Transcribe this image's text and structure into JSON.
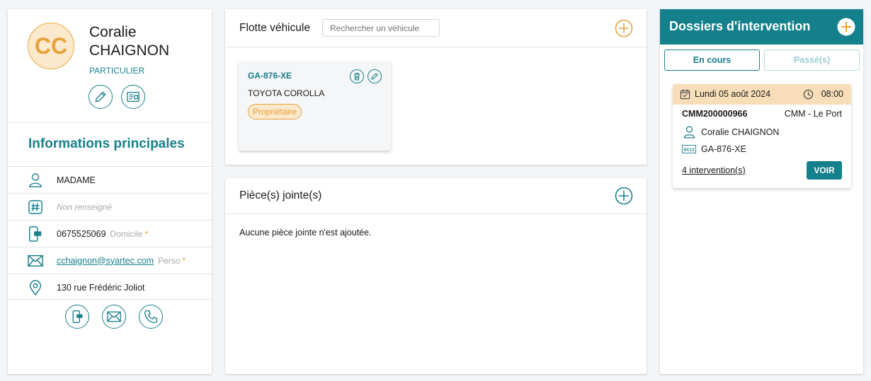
{
  "client": {
    "initials": "CC",
    "first_name": "Coralie",
    "last_name": "CHAIGNON",
    "type": "PARTICULIER"
  },
  "info": {
    "title": "Informations principales",
    "civility": "MADAME",
    "id_placeholder": "Non renseigné",
    "phone": "0675525069",
    "phone_label": "Domicile",
    "email": "cchaignon@syartec.com",
    "email_label": "Perso",
    "required_marker": "*",
    "address": "130 rue Frédéric Joliot"
  },
  "fleet": {
    "title": "Flotte véhicule",
    "search_placeholder": "Rechercher un véhicule",
    "vehicles": [
      {
        "plate": "GA-876-XE",
        "model": "TOYOTA COROLLA",
        "role": "Propriétaire"
      }
    ]
  },
  "attachments": {
    "title": "Pièce(s) jointe(s)",
    "empty_message": "Aucune pièce jointe n'est ajoutée."
  },
  "files": {
    "title": "Dossiers d'intervention",
    "tabs": [
      {
        "label": "En cours",
        "active": true
      },
      {
        "label": "Passé(s)",
        "active": false
      }
    ],
    "items": [
      {
        "date": "Lundi 05 août 2024",
        "time": "08:00",
        "code": "CMM200000966",
        "site": "CMM - Le Port",
        "client": "Coralie CHAIGNON",
        "plate_icon_text": "BC12",
        "plate": "GA-876-XE",
        "interventions_link": "4 intervention(s)",
        "action": "VOIR"
      }
    ]
  },
  "colors": {
    "primary": "#13808b",
    "accent": "#e8a23a",
    "accent_light": "#fbe9cd"
  }
}
